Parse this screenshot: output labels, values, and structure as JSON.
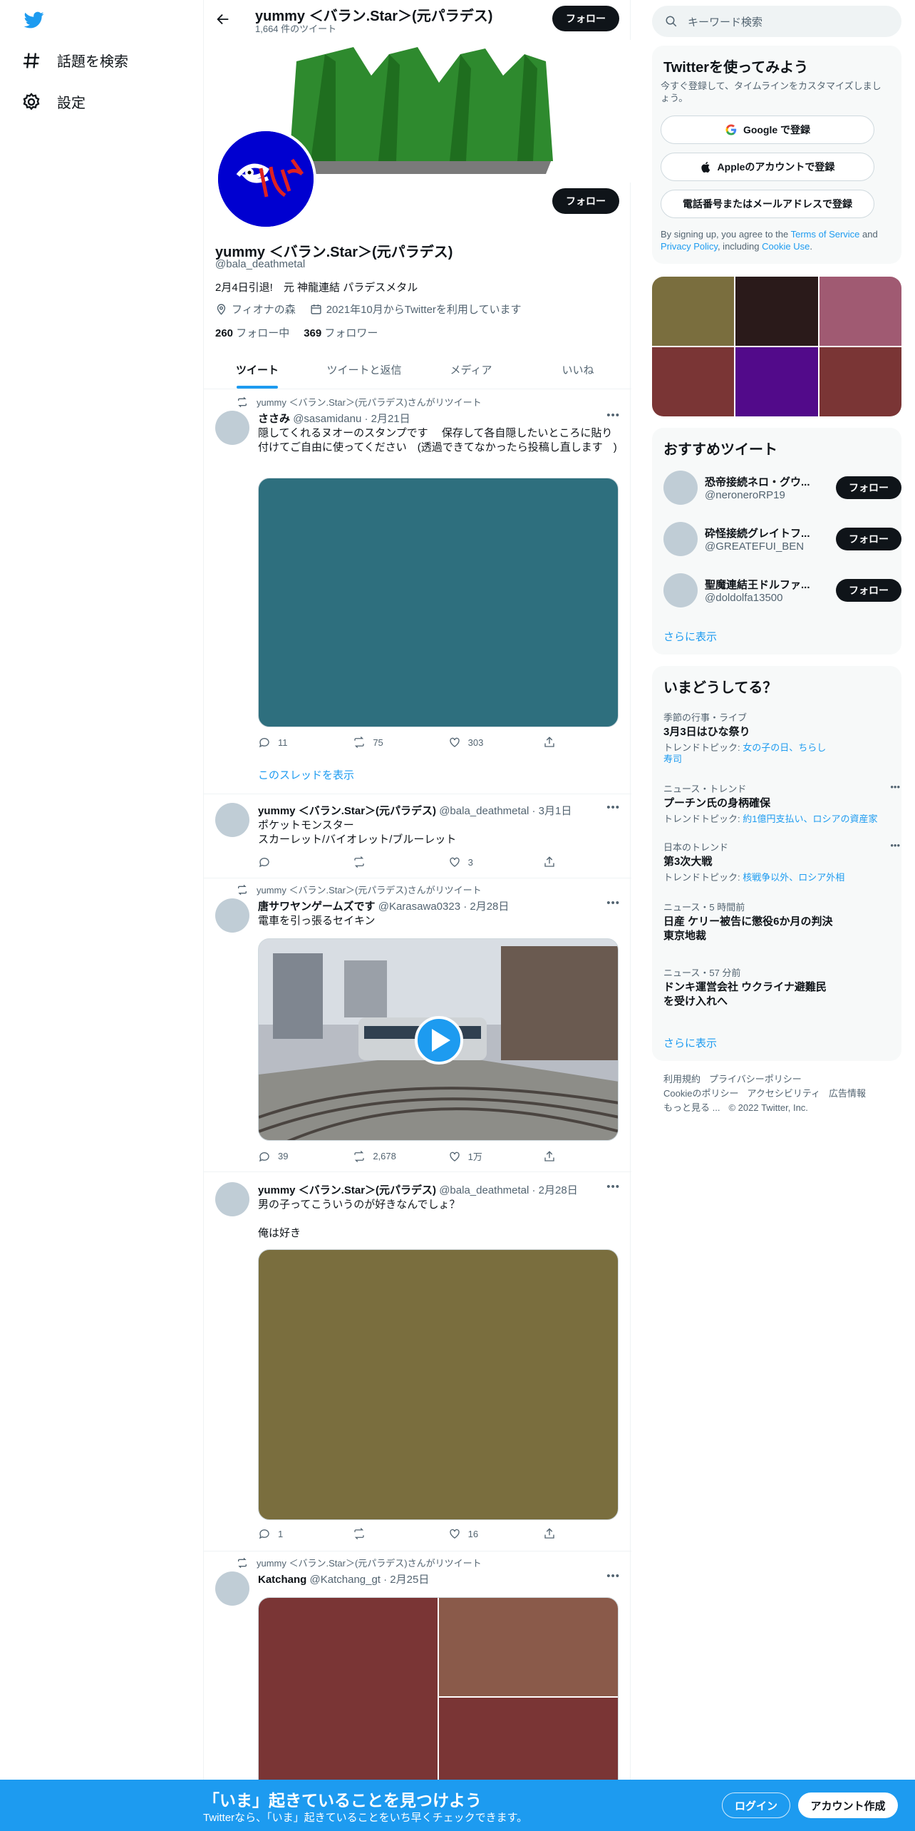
{
  "nav": {
    "explore": "話題を検索",
    "settings": "設定"
  },
  "header": {
    "title": "yummy ＜バラン.Star＞(元パラデス)",
    "tweet_count": "1,664 件のツイート",
    "follow": "フォロー"
  },
  "profile": {
    "name": "yummy ＜バラン.Star＞(元パラデス)",
    "handle": "@bala_deathmetal",
    "bio": "2月4日引退!　元 神龍連結 パラデスメタル",
    "location": "フィオナの森",
    "joined": "2021年10月からTwitterを利用しています",
    "following_count": "260",
    "following_label": "フォロー中",
    "followers_count": "369",
    "followers_label": "フォロワー",
    "follow": "フォロー"
  },
  "tabs": [
    "ツイート",
    "ツイートと返信",
    "メディア",
    "いいね"
  ],
  "tweets": [
    {
      "retweet": "yummy ＜バラン.Star＞(元パラデス)さんがリツイート",
      "name": "ささみ",
      "meta": "@sasamidanu · 2月21日",
      "text": "隠してくれるヌオーのスタンプです　 保存して各自隠したいところに貼り付けてご自由に使ってください　(透過できてなかったら投稿し直します　)",
      "media_color": "#2e6f7e",
      "reply": "11",
      "retweets": "75",
      "likes": "303",
      "thread_link": "このスレッドを表示"
    },
    {
      "name": "yummy ＜バラン.Star＞(元パラデス)",
      "meta": "@bala_deathmetal · 3月1日",
      "text": "ポケットモンスター\nスカーレット/バイオレット/ブルーレット",
      "reply": "",
      "retweets": "",
      "likes": "3"
    },
    {
      "retweet": "yummy ＜バラン.Star＞(元パラデス)さんがリツイート",
      "name": "唐サワヤンゲームズです",
      "meta": "@Karasawa0323 · 2月28日",
      "text": "電車を引っ張るセイキン",
      "reply": "39",
      "retweets": "2,678",
      "likes": "1万"
    },
    {
      "name": "yummy ＜バラン.Star＞(元パラデス)",
      "meta": "@bala_deathmetal · 2月28日",
      "text": "男の子ってこういうのが好きなんでしょ？\n\n俺は好き",
      "media_color": "#7a6e3e",
      "reply": "1",
      "retweets": "",
      "likes": "16"
    },
    {
      "retweet": "yummy ＜バラン.Star＞(元パラデス)さんがリツイート",
      "name": "Katchang",
      "meta": "@Katchang_gt · 2月25日",
      "media_colors": [
        "#7a3535",
        "#8a5a4a",
        "#7a3535"
      ]
    }
  ],
  "search": {
    "placeholder": "キーワード検索"
  },
  "signup": {
    "title": "Twitterを使ってみよう",
    "sub": "今すぐ登録して、タイムラインをカスタマイズしましょう。",
    "google": "Google で登録",
    "apple": "Appleのアカウントで登録",
    "phone": "電話番号またはメールアドレスで登録",
    "terms_pre": "By signing up, you agree to the ",
    "terms_tos": "Terms of Service",
    "terms_and": " and ",
    "terms_privacy": "Privacy Policy",
    "terms_incl": ", including ",
    "terms_cookie": "Cookie Use",
    "terms_end": "."
  },
  "photo_colors": [
    "#7a6e3e",
    "#2a1a1a",
    "#a05a72",
    "#7a3535",
    "#520a8a",
    "#7a3535"
  ],
  "recommended": {
    "title": "おすすめツイート",
    "users": [
      {
        "name": "恐帝接続ネロ・グウ...",
        "handle": "@neroneroRP19"
      },
      {
        "name": "砕怪接続グレイトフ...",
        "handle": "@GREATEFUI_BEN"
      },
      {
        "name": "聖魔連結王ドルファ...",
        "handle": "@doldolfa13500"
      }
    ],
    "follow": "フォロー",
    "more": "さらに表示"
  },
  "trends": {
    "title": "いまどうしてる？",
    "items": [
      {
        "cat": "季節の行事・ライブ",
        "title": "3月3日はひな祭り",
        "sub_pre": "トレンドトピック: ",
        "sub_links": "女の子の日、ちらし寿司"
      },
      {
        "cat": "ニュース・トレンド",
        "title": "プーチン氏の身柄確保",
        "sub_pre": "トレンドトピック: ",
        "sub_links": "約1億円支払い、ロシアの資産家"
      },
      {
        "cat": "日本のトレンド",
        "title": "第3次大戦",
        "sub_pre": "トレンドトピック: ",
        "sub_links": "核戦争以外、ロシア外相"
      },
      {
        "cat": "ニュース・5 時間前",
        "title": "日産 ケリー被告に懲役6か月の判決 東京地裁"
      },
      {
        "cat": "ニュース・57 分前",
        "title": "ドンキ運営会社 ウクライナ避難民を受け入れへ"
      }
    ],
    "more": "さらに表示"
  },
  "footer": {
    "terms": "利用規約",
    "privacy": "プライバシーポリシー",
    "cookie": "Cookieのポリシー",
    "accessibility": "アクセシビリティ",
    "ads": "広告情報",
    "more": "もっと見る ...",
    "copyright": "© 2022 Twitter, Inc."
  },
  "bottom": {
    "title": "「いま」起きていることを見つけよう",
    "sub": "Twitterなら、「いま」起きていることをいち早くチェックできます。",
    "login": "ログイン",
    "signup": "アカウント作成"
  }
}
